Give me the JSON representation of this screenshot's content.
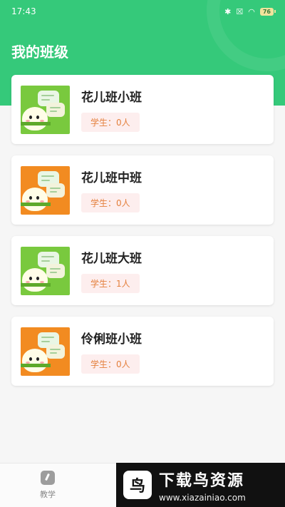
{
  "status_bar": {
    "time": "17:43",
    "battery": "76"
  },
  "page": {
    "title": "我的班级"
  },
  "classes": [
    {
      "name": "花儿班小班",
      "students": "学生：0人",
      "thumb_color": "#79c93e"
    },
    {
      "name": "花儿班中班",
      "students": "学生：0人",
      "thumb_color": "#f28b21"
    },
    {
      "name": "花儿班大班",
      "students": "学生：1人",
      "thumb_color": "#79c93e"
    },
    {
      "name": "伶俐班小班",
      "students": "学生：0人",
      "thumb_color": "#f28b21"
    }
  ],
  "bottom_nav": {
    "teaching_label": "教学"
  },
  "watermark": {
    "title": "下载鸟资源",
    "url": "www.xiazainiao.com"
  },
  "colors": {
    "header_green": "#35c97a",
    "badge_text": "#e4803d",
    "badge_bg": "#fdeeee"
  }
}
